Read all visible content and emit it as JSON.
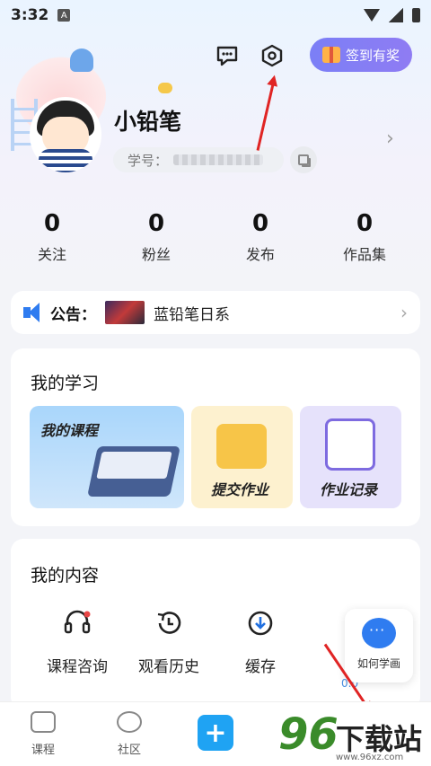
{
  "status_bar": {
    "time": "3:32",
    "notification_glyph": "A"
  },
  "header": {
    "checkin_label": "签到有奖",
    "icons": [
      "message-icon",
      "settings-icon",
      "gift-icon"
    ]
  },
  "profile": {
    "username": "小铅笔",
    "uid_label": "学号：",
    "chevron": "›"
  },
  "stats": [
    {
      "value": "0",
      "label": "关注"
    },
    {
      "value": "0",
      "label": "粉丝"
    },
    {
      "value": "0",
      "label": "发布"
    },
    {
      "value": "0",
      "label": "作品集"
    }
  ],
  "announcement": {
    "label": "公告：",
    "text": "蓝铅笔日系",
    "chevron": "›"
  },
  "my_learning": {
    "title": "我的学习",
    "tiles": [
      {
        "label": "我的课程"
      },
      {
        "label": "提交作业"
      },
      {
        "label": "作业记录"
      }
    ]
  },
  "my_content": {
    "title": "我的内容",
    "items": [
      {
        "label": "课程咨询",
        "icon": "headset-icon"
      },
      {
        "label": "观看历史",
        "icon": "history-icon"
      },
      {
        "label": "缓存",
        "icon": "download-icon"
      }
    ],
    "peek_value": "0.0"
  },
  "help_float": {
    "label": "如何学画"
  },
  "bottom_nav": {
    "items": [
      {
        "label": "课程",
        "icon": "tv-icon"
      },
      {
        "label": "社区",
        "icon": "planet-icon"
      }
    ],
    "add_symbol": "+"
  },
  "watermark": {
    "number": "96",
    "text": "下载站",
    "url": "www.96xz.com"
  },
  "colors": {
    "accent": "#2f7cf0",
    "checkin": "#7b7ff6",
    "annotation_arrow": "#e02424"
  }
}
